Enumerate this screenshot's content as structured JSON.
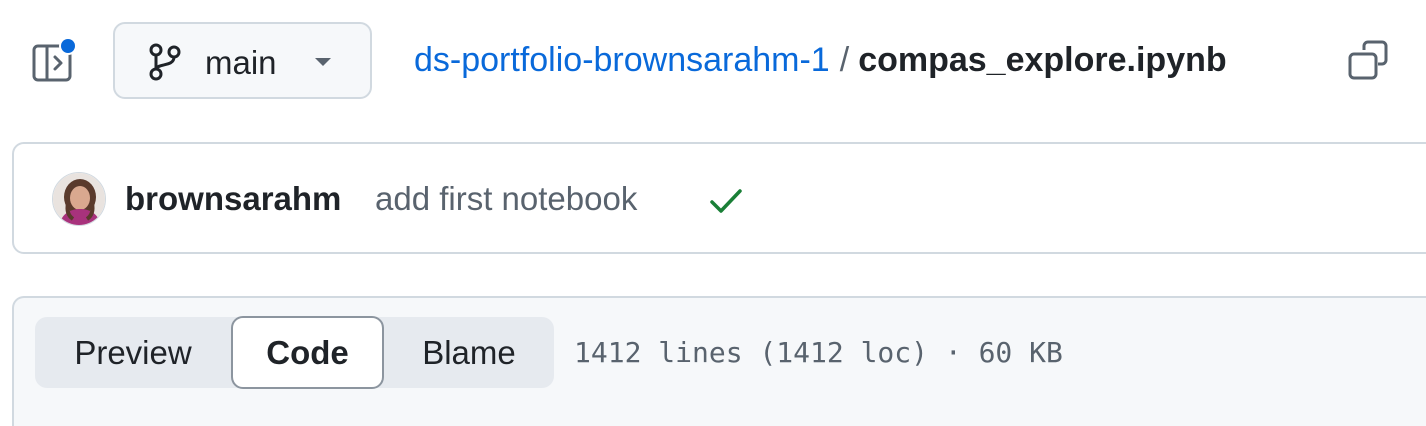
{
  "header": {
    "sidebar_toggle_icon": "sidebar-expand-icon",
    "notification_dot_color": "#0969da",
    "branch": {
      "icon": "git-branch-icon",
      "label": "main",
      "caret_icon": "triangle-down-icon"
    },
    "breadcrumb": {
      "repo": "ds-portfolio-brownsarahm-1",
      "separator": "/",
      "file": "compas_explore.ipynb"
    },
    "copy_path_icon": "copy-icon"
  },
  "commit": {
    "avatar": "avatar",
    "author": "brownsarahm",
    "message": "add first notebook",
    "status_icon": "check-icon",
    "status_color": "#1a7f37"
  },
  "file_view": {
    "tabs": [
      {
        "label": "Preview",
        "selected": false
      },
      {
        "label": "Code",
        "selected": true
      },
      {
        "label": "Blame",
        "selected": false
      }
    ],
    "stats": "1412 lines (1412 loc) · 60 KB"
  },
  "colors": {
    "link": "#0969da",
    "text": "#1f2328",
    "muted": "#59636e",
    "border": "#d1d9e0",
    "subtle_bg": "#f6f8fa"
  }
}
